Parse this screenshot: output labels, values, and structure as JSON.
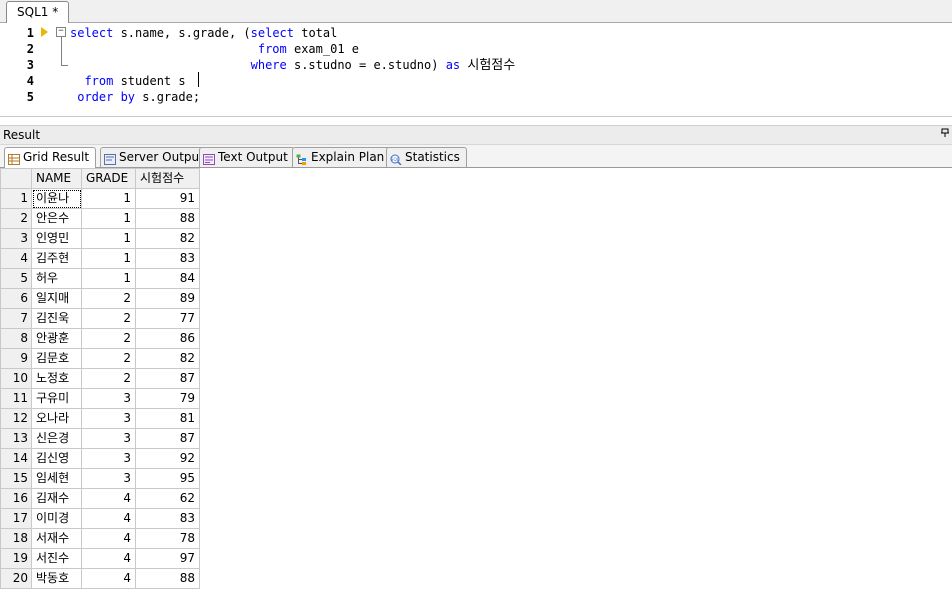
{
  "editor_tab": {
    "label": "SQL1 *"
  },
  "editor": {
    "line_numbers": [
      "1",
      "2",
      "3",
      "4",
      "5"
    ],
    "lines": [
      [
        {
          "t": "select",
          "k": true
        },
        {
          "t": " s.name, s.grade, (",
          "k": false
        },
        {
          "t": "select",
          "k": true
        },
        {
          "t": " total",
          "k": false
        }
      ],
      [
        {
          "t": "                          ",
          "k": false
        },
        {
          "t": "from",
          "k": true
        },
        {
          "t": " exam_01 e",
          "k": false
        }
      ],
      [
        {
          "t": "                         ",
          "k": false
        },
        {
          "t": "where",
          "k": true
        },
        {
          "t": " s.studno = e.studno) ",
          "k": false
        },
        {
          "t": "as",
          "k": true
        },
        {
          "t": " ",
          "k": false
        },
        {
          "t": "시험점수",
          "k": false,
          "kr": true
        }
      ],
      [
        {
          "t": "  ",
          "k": false
        },
        {
          "t": "from",
          "k": true
        },
        {
          "t": " student s",
          "k": false
        }
      ],
      [
        {
          "t": " ",
          "k": false
        },
        {
          "t": "order by",
          "k": true
        },
        {
          "t": " s.grade;",
          "k": false
        }
      ]
    ]
  },
  "result_panel": {
    "title": "Result",
    "pin_icon": "pin-icon"
  },
  "result_tabs": [
    {
      "label": "Grid Result",
      "icon": "grid-icon",
      "active": true
    },
    {
      "label": "Server Output",
      "icon": "server-output-icon",
      "active": false
    },
    {
      "label": "Text Output",
      "icon": "text-output-icon",
      "active": false
    },
    {
      "label": "Explain Plan",
      "icon": "explain-plan-icon",
      "active": false
    },
    {
      "label": "Statistics",
      "icon": "statistics-icon",
      "active": false
    }
  ],
  "grid": {
    "columns": [
      "NAME",
      "GRADE",
      "시험점수"
    ],
    "rows": [
      [
        "1",
        "이윤나",
        "1",
        "91"
      ],
      [
        "2",
        "안은수",
        "1",
        "88"
      ],
      [
        "3",
        "인영민",
        "1",
        "82"
      ],
      [
        "4",
        "김주현",
        "1",
        "83"
      ],
      [
        "5",
        "허우",
        "1",
        "84"
      ],
      [
        "6",
        "일지매",
        "2",
        "89"
      ],
      [
        "7",
        "김진욱",
        "2",
        "77"
      ],
      [
        "8",
        "안광훈",
        "2",
        "86"
      ],
      [
        "9",
        "김문호",
        "2",
        "82"
      ],
      [
        "10",
        "노정호",
        "2",
        "87"
      ],
      [
        "11",
        "구유미",
        "3",
        "79"
      ],
      [
        "12",
        "오나라",
        "3",
        "81"
      ],
      [
        "13",
        "신은경",
        "3",
        "87"
      ],
      [
        "14",
        "김신영",
        "3",
        "92"
      ],
      [
        "15",
        "임세현",
        "3",
        "95"
      ],
      [
        "16",
        "김재수",
        "4",
        "62"
      ],
      [
        "17",
        "이미경",
        "4",
        "83"
      ],
      [
        "18",
        "서재수",
        "4",
        "78"
      ],
      [
        "19",
        "서진수",
        "4",
        "97"
      ],
      [
        "20",
        "박동호",
        "4",
        "88"
      ]
    ]
  },
  "colors": {
    "keyword": "#0000ff",
    "marker": "#e6b800"
  }
}
